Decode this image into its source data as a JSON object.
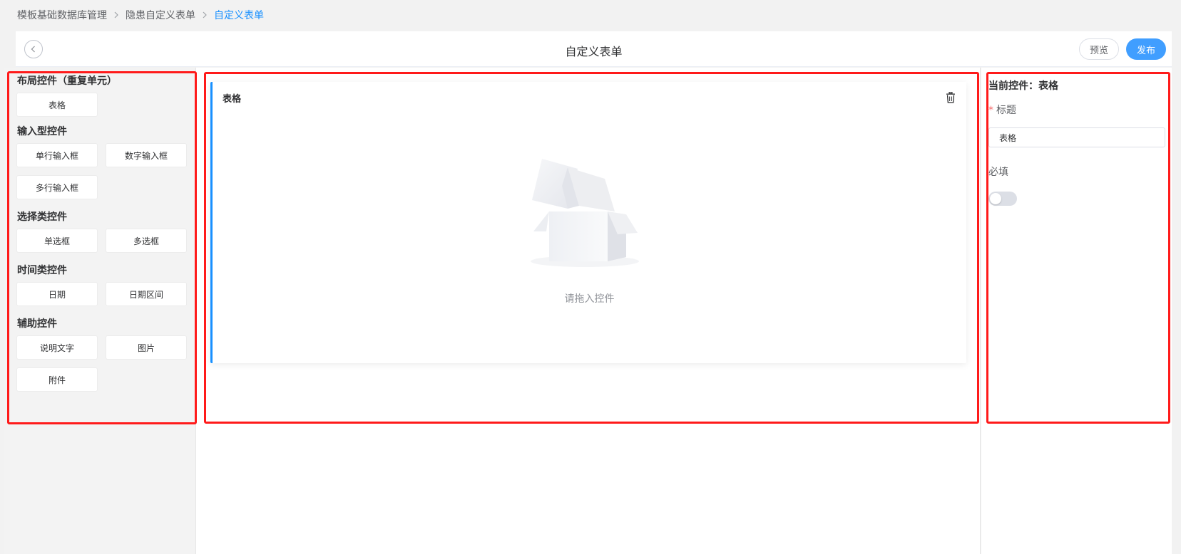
{
  "breadcrumb": {
    "items": [
      "模板基础数据库管理",
      "隐患自定义表单",
      "自定义表单"
    ]
  },
  "header": {
    "title": "自定义表单",
    "preview_label": "预览",
    "publish_label": "发布"
  },
  "palette": {
    "groups": [
      {
        "title": "布局控件（重复单元）",
        "items": [
          "表格"
        ]
      },
      {
        "title": "输入型控件",
        "items": [
          "单行输入框",
          "数字输入框",
          "多行输入框"
        ]
      },
      {
        "title": "选择类控件",
        "items": [
          "单选框",
          "多选框"
        ]
      },
      {
        "title": "时间类控件",
        "items": [
          "日期",
          "日期区间"
        ]
      },
      {
        "title": "辅助控件",
        "items": [
          "说明文字",
          "图片",
          "附件"
        ]
      }
    ]
  },
  "canvas": {
    "card_title": "表格",
    "empty_text": "请拖入控件"
  },
  "properties": {
    "title": "当前控件：表格",
    "title_label": "标题",
    "title_value": "表格",
    "required_label": "必填",
    "required_on": false
  },
  "colors": {
    "accent": "#409eff",
    "highlight": "#ff1a1a"
  }
}
